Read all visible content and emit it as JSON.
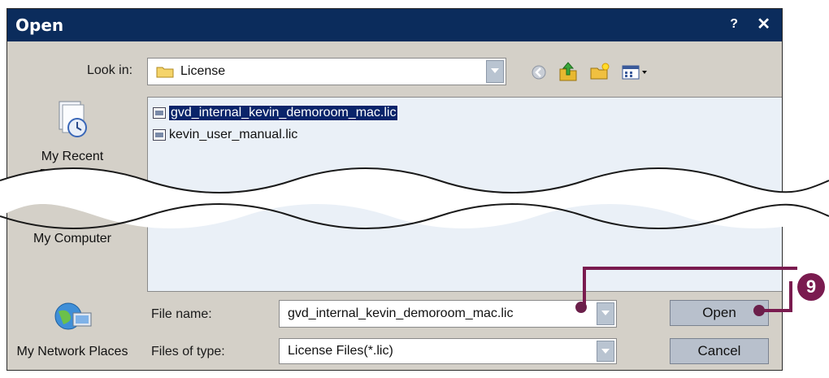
{
  "dialog": {
    "title": "Open",
    "help_label": "?",
    "close_label": "✕"
  },
  "look_in": {
    "label": "Look in:",
    "value": "License"
  },
  "files": [
    {
      "name": "gvd_internal_kevin_demoroom_mac.lic",
      "selected": true
    },
    {
      "name": "kevin_user_manual.lic",
      "selected": false
    }
  ],
  "places": [
    {
      "label": "My Recent Documents"
    },
    {
      "label": "My Computer"
    },
    {
      "label": "My Network Places"
    }
  ],
  "file_name": {
    "label": "File name:",
    "value": "gvd_internal_kevin_demoroom_mac.lic"
  },
  "file_type": {
    "label": "Files of type:",
    "value": "License Files(*.lic)"
  },
  "buttons": {
    "open": "Open",
    "cancel": "Cancel"
  },
  "callout": {
    "number": "9",
    "color": "#7a1b4f"
  },
  "colors": {
    "titlebar": "#0b2c5c",
    "dialog_bg": "#d4d0c8",
    "selection": "#0a246a"
  },
  "icons": [
    "back-icon",
    "up-folder-icon",
    "new-folder-icon",
    "views-menu-icon"
  ]
}
